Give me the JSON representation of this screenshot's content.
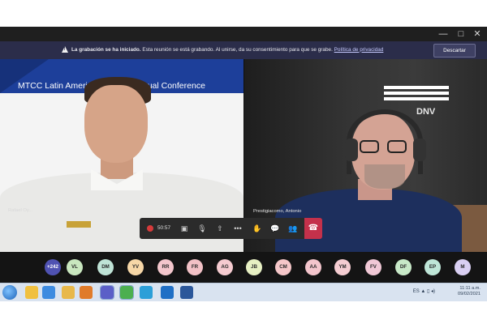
{
  "window": {
    "controls": {
      "minimize": "—",
      "maximize": "□",
      "close": "✕"
    }
  },
  "banner": {
    "title": "La grabación se ha iniciado.",
    "message": " Esta reunión se está grabando. Al unirse, da su consentimiento para que se grabe.",
    "link": "Política de privacidad",
    "dismiss": "Descartar",
    "icon": "warning-icon"
  },
  "tiles": {
    "left": {
      "conference_title": "MTCC Latin America Regional Virtual Conference",
      "name_label": "Rafael Oy..."
    },
    "right": {
      "name_label": "Prestigiacomo, Antonio",
      "logo_text": "DNV"
    }
  },
  "toolbar": {
    "timer": "50:57",
    "buttons": [
      {
        "name": "recording-indicator",
        "icon": "record-icon"
      },
      {
        "name": "camera-button",
        "icon": "camera-icon",
        "glyph": "▣"
      },
      {
        "name": "mic-button",
        "icon": "microphone-icon",
        "glyph": "🎙"
      },
      {
        "name": "share-button",
        "icon": "share-screen-icon",
        "glyph": "⇧"
      },
      {
        "name": "more-button",
        "icon": "more-icon",
        "glyph": "•••"
      },
      {
        "name": "raise-hand-button",
        "icon": "hand-icon",
        "glyph": "✋"
      },
      {
        "name": "chat-button",
        "icon": "chat-icon",
        "glyph": "💬"
      },
      {
        "name": "participants-button",
        "icon": "people-icon",
        "glyph": "👥"
      },
      {
        "name": "hangup-button",
        "icon": "phone-hangup-icon",
        "glyph": "☎"
      }
    ]
  },
  "participants": {
    "more_count": "+242",
    "chips": [
      {
        "initials": "VL",
        "color": "#c9e7bf"
      },
      {
        "initials": "DM",
        "color": "#bfe3d6"
      },
      {
        "initials": "YV",
        "color": "#f6d7a7"
      },
      {
        "initials": "RR",
        "color": "#f3c6cc"
      },
      {
        "initials": "FR",
        "color": "#f2c1c6"
      },
      {
        "initials": "AG",
        "color": "#f5cbd0"
      },
      {
        "initials": "JB",
        "color": "#e7f0c3"
      },
      {
        "initials": "CM",
        "color": "#f5c7c9"
      },
      {
        "initials": "AA",
        "color": "#f3c5cc"
      },
      {
        "initials": "YM",
        "color": "#f5cdd2"
      },
      {
        "initials": "FV",
        "color": "#f0c8d6"
      },
      {
        "initials": "DF",
        "color": "#c8e9c8"
      },
      {
        "initials": "EP",
        "color": "#bfe6d8"
      },
      {
        "initials": "M",
        "color": "#d9cff2"
      }
    ]
  },
  "taskbar": {
    "apps": [
      {
        "name": "explorer-icon",
        "color": "#f0c040"
      },
      {
        "name": "ie-icon",
        "color": "#3d8be0"
      },
      {
        "name": "folder-icon",
        "color": "#e8b84a"
      },
      {
        "name": "media-player-icon",
        "color": "#e07b2a"
      },
      {
        "name": "teams-icon",
        "color": "#5b5fc7"
      },
      {
        "name": "chrome-icon",
        "color": "#4caf50"
      },
      {
        "name": "edge-icon",
        "color": "#2c9fd8"
      },
      {
        "name": "outlook-icon",
        "color": "#1f6fc5"
      },
      {
        "name": "word-icon",
        "color": "#2b579a"
      }
    ],
    "tray_lang": "ES",
    "time": "11:11 a.m.",
    "date": "09/02/2021"
  }
}
